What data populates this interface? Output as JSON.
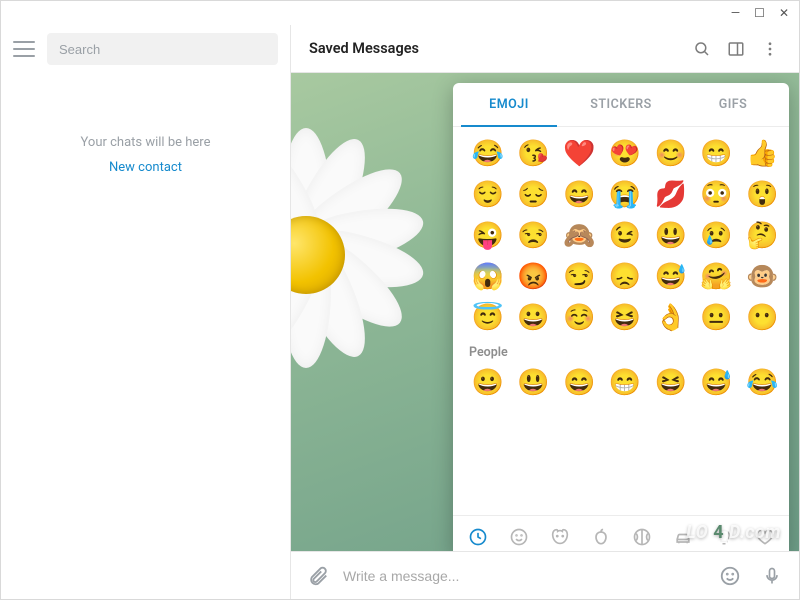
{
  "window_controls": {
    "min": "—",
    "max": "☐",
    "close": "✕"
  },
  "sidebar": {
    "search_placeholder": "Search",
    "empty_text": "Your chats will be here",
    "new_contact": "New contact"
  },
  "header": {
    "title": "Saved Messages"
  },
  "emoji_panel": {
    "tabs": [
      "EMOJI",
      "STICKERS",
      "GIFS"
    ],
    "active_tab": 0,
    "recent": [
      "😂",
      "😘",
      "❤️",
      "😍",
      "😊",
      "😁",
      "👍",
      "😌",
      "😔",
      "😄",
      "😭",
      "💋",
      "😳",
      "😲",
      "😜",
      "😒",
      "🙈",
      "😉",
      "😃",
      "😢",
      "🤔",
      "😱",
      "😡",
      "😏",
      "😞",
      "😅",
      "🤗",
      "🐵",
      "😇",
      "😀",
      "☺️",
      "😆",
      "👌",
      "😐",
      "😶"
    ],
    "section_label": "People",
    "people": [
      "😀",
      "😃",
      "😄",
      "😁",
      "😆",
      "😅",
      "😂"
    ],
    "categories": [
      "recent",
      "smileys",
      "animals",
      "food",
      "activity",
      "travel",
      "objects",
      "symbols"
    ]
  },
  "composer": {
    "placeholder": "Write a message..."
  },
  "watermark": {
    "a": "LO",
    "b": "4",
    "c": "D.com"
  }
}
